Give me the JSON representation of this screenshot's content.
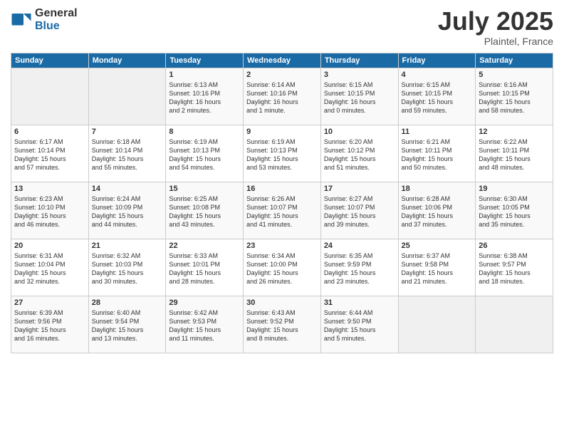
{
  "logo": {
    "general": "General",
    "blue": "Blue"
  },
  "title": "July 2025",
  "location": "Plaintel, France",
  "days_of_week": [
    "Sunday",
    "Monday",
    "Tuesday",
    "Wednesday",
    "Thursday",
    "Friday",
    "Saturday"
  ],
  "weeks": [
    [
      {
        "day": "",
        "info": ""
      },
      {
        "day": "",
        "info": ""
      },
      {
        "day": "1",
        "info": "Sunrise: 6:13 AM\nSunset: 10:16 PM\nDaylight: 16 hours\nand 2 minutes."
      },
      {
        "day": "2",
        "info": "Sunrise: 6:14 AM\nSunset: 10:16 PM\nDaylight: 16 hours\nand 1 minute."
      },
      {
        "day": "3",
        "info": "Sunrise: 6:15 AM\nSunset: 10:15 PM\nDaylight: 16 hours\nand 0 minutes."
      },
      {
        "day": "4",
        "info": "Sunrise: 6:15 AM\nSunset: 10:15 PM\nDaylight: 15 hours\nand 59 minutes."
      },
      {
        "day": "5",
        "info": "Sunrise: 6:16 AM\nSunset: 10:15 PM\nDaylight: 15 hours\nand 58 minutes."
      }
    ],
    [
      {
        "day": "6",
        "info": "Sunrise: 6:17 AM\nSunset: 10:14 PM\nDaylight: 15 hours\nand 57 minutes."
      },
      {
        "day": "7",
        "info": "Sunrise: 6:18 AM\nSunset: 10:14 PM\nDaylight: 15 hours\nand 55 minutes."
      },
      {
        "day": "8",
        "info": "Sunrise: 6:19 AM\nSunset: 10:13 PM\nDaylight: 15 hours\nand 54 minutes."
      },
      {
        "day": "9",
        "info": "Sunrise: 6:19 AM\nSunset: 10:13 PM\nDaylight: 15 hours\nand 53 minutes."
      },
      {
        "day": "10",
        "info": "Sunrise: 6:20 AM\nSunset: 10:12 PM\nDaylight: 15 hours\nand 51 minutes."
      },
      {
        "day": "11",
        "info": "Sunrise: 6:21 AM\nSunset: 10:11 PM\nDaylight: 15 hours\nand 50 minutes."
      },
      {
        "day": "12",
        "info": "Sunrise: 6:22 AM\nSunset: 10:11 PM\nDaylight: 15 hours\nand 48 minutes."
      }
    ],
    [
      {
        "day": "13",
        "info": "Sunrise: 6:23 AM\nSunset: 10:10 PM\nDaylight: 15 hours\nand 46 minutes."
      },
      {
        "day": "14",
        "info": "Sunrise: 6:24 AM\nSunset: 10:09 PM\nDaylight: 15 hours\nand 44 minutes."
      },
      {
        "day": "15",
        "info": "Sunrise: 6:25 AM\nSunset: 10:08 PM\nDaylight: 15 hours\nand 43 minutes."
      },
      {
        "day": "16",
        "info": "Sunrise: 6:26 AM\nSunset: 10:07 PM\nDaylight: 15 hours\nand 41 minutes."
      },
      {
        "day": "17",
        "info": "Sunrise: 6:27 AM\nSunset: 10:07 PM\nDaylight: 15 hours\nand 39 minutes."
      },
      {
        "day": "18",
        "info": "Sunrise: 6:28 AM\nSunset: 10:06 PM\nDaylight: 15 hours\nand 37 minutes."
      },
      {
        "day": "19",
        "info": "Sunrise: 6:30 AM\nSunset: 10:05 PM\nDaylight: 15 hours\nand 35 minutes."
      }
    ],
    [
      {
        "day": "20",
        "info": "Sunrise: 6:31 AM\nSunset: 10:04 PM\nDaylight: 15 hours\nand 32 minutes."
      },
      {
        "day": "21",
        "info": "Sunrise: 6:32 AM\nSunset: 10:03 PM\nDaylight: 15 hours\nand 30 minutes."
      },
      {
        "day": "22",
        "info": "Sunrise: 6:33 AM\nSunset: 10:01 PM\nDaylight: 15 hours\nand 28 minutes."
      },
      {
        "day": "23",
        "info": "Sunrise: 6:34 AM\nSunset: 10:00 PM\nDaylight: 15 hours\nand 26 minutes."
      },
      {
        "day": "24",
        "info": "Sunrise: 6:35 AM\nSunset: 9:59 PM\nDaylight: 15 hours\nand 23 minutes."
      },
      {
        "day": "25",
        "info": "Sunrise: 6:37 AM\nSunset: 9:58 PM\nDaylight: 15 hours\nand 21 minutes."
      },
      {
        "day": "26",
        "info": "Sunrise: 6:38 AM\nSunset: 9:57 PM\nDaylight: 15 hours\nand 18 minutes."
      }
    ],
    [
      {
        "day": "27",
        "info": "Sunrise: 6:39 AM\nSunset: 9:56 PM\nDaylight: 15 hours\nand 16 minutes."
      },
      {
        "day": "28",
        "info": "Sunrise: 6:40 AM\nSunset: 9:54 PM\nDaylight: 15 hours\nand 13 minutes."
      },
      {
        "day": "29",
        "info": "Sunrise: 6:42 AM\nSunset: 9:53 PM\nDaylight: 15 hours\nand 11 minutes."
      },
      {
        "day": "30",
        "info": "Sunrise: 6:43 AM\nSunset: 9:52 PM\nDaylight: 15 hours\nand 8 minutes."
      },
      {
        "day": "31",
        "info": "Sunrise: 6:44 AM\nSunset: 9:50 PM\nDaylight: 15 hours\nand 5 minutes."
      },
      {
        "day": "",
        "info": ""
      },
      {
        "day": "",
        "info": ""
      }
    ]
  ]
}
